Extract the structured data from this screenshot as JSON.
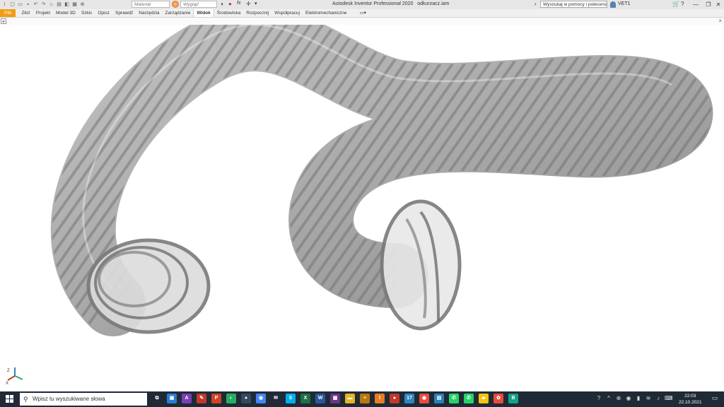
{
  "window": {
    "title": "Autodesk Inventor Professional 2020",
    "document": "odkurzacz.iam",
    "material_placeholder": "Materiał",
    "appearance_placeholder": "Wygląd",
    "search_placeholder": "Wyszukaj w pomocy i poleceniach",
    "user": "VET1",
    "minimize": "—",
    "restore": "❐",
    "close": "✕"
  },
  "ribbon": {
    "tabs": [
      {
        "label": "Plik"
      },
      {
        "label": "Złóż"
      },
      {
        "label": "Projekt"
      },
      {
        "label": "Model 3D"
      },
      {
        "label": "Szkic"
      },
      {
        "label": "Opisz"
      },
      {
        "label": "Sprawdź"
      },
      {
        "label": "Narzędzia"
      },
      {
        "label": "Zarządzanie"
      },
      {
        "label": "Widok"
      },
      {
        "label": "Środowiska"
      },
      {
        "label": "Rozpocznij"
      },
      {
        "label": "Współpracuj"
      },
      {
        "label": "Elektromechaniczne"
      }
    ],
    "active_tab": "Widok",
    "file_color": "#f39c12"
  },
  "docstrip": {
    "plus": "+",
    "close": "×"
  },
  "viewport": {
    "model": "flexible-hose-spring",
    "hose_color": "#8a8a8a"
  },
  "taskbar": {
    "search_placeholder": "Wpisz tu wyszukiwane słowa",
    "apps": [
      {
        "icon": "task-view-icon",
        "glyph": "⧉",
        "color": "#1f2a36"
      },
      {
        "icon": "photos-icon",
        "glyph": "▣",
        "color": "#2b7cd3"
      },
      {
        "icon": "affinity-icon",
        "glyph": "A",
        "color": "#7b3fb5"
      },
      {
        "icon": "pen-icon",
        "glyph": "✎",
        "color": "#c0392b"
      },
      {
        "icon": "powerpoint-icon",
        "glyph": "P",
        "color": "#d04423"
      },
      {
        "icon": "paint-icon",
        "glyph": "◐",
        "color": "#27ae60"
      },
      {
        "icon": "camera-icon",
        "glyph": "●",
        "color": "#34495e"
      },
      {
        "icon": "chrome-icon",
        "glyph": "◉",
        "color": "#4285f4"
      },
      {
        "icon": "mail-icon",
        "glyph": "✉",
        "color": "#1f2a36"
      },
      {
        "icon": "skype-icon",
        "glyph": "S",
        "color": "#00aff0"
      },
      {
        "icon": "excel-icon",
        "glyph": "X",
        "color": "#1d7044"
      },
      {
        "icon": "word-icon",
        "glyph": "W",
        "color": "#2b579a"
      },
      {
        "icon": "calculator-icon",
        "glyph": "▦",
        "color": "#6c3483"
      },
      {
        "icon": "folder-icon",
        "glyph": "▬",
        "color": "#e6b422"
      },
      {
        "icon": "notes-icon",
        "glyph": "≡",
        "color": "#b9770e"
      },
      {
        "icon": "inventor-icon",
        "glyph": "I",
        "color": "#e67e22"
      },
      {
        "icon": "record-icon",
        "glyph": "●",
        "color": "#c0392b"
      },
      {
        "icon": "calendar-icon",
        "glyph": "17",
        "color": "#2e86c1"
      },
      {
        "icon": "chrome-profile-icon",
        "glyph": "◉",
        "color": "#e74c3c"
      },
      {
        "icon": "doc-icon",
        "glyph": "▤",
        "color": "#2980b9"
      },
      {
        "icon": "whatsapp-icon",
        "glyph": "✆",
        "color": "#25d366"
      },
      {
        "icon": "whatsapp-web-icon",
        "glyph": "✆",
        "color": "#25d366"
      },
      {
        "icon": "sticky-notes-icon",
        "glyph": "▰",
        "color": "#f1c40f"
      },
      {
        "icon": "app-icon",
        "glyph": "✿",
        "color": "#e74c3c"
      },
      {
        "icon": "b-app-icon",
        "glyph": "B",
        "color": "#16a085"
      }
    ],
    "tray_icons": [
      "help-icon",
      "chevron-up-icon",
      "network-icon",
      "app-tray-icon",
      "battery-icon",
      "wifi-icon",
      "volume-icon",
      "keyboard-icon"
    ],
    "time": "22:03",
    "date": "22.10.2021"
  }
}
